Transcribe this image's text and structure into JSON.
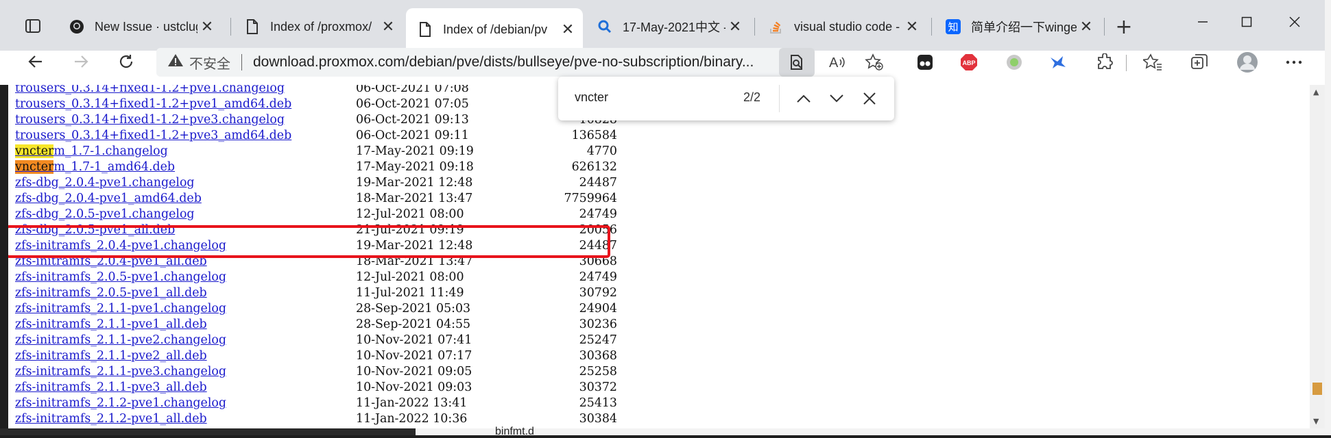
{
  "tabs": [
    {
      "title": "New Issue · ustclug/",
      "icon": "github-icon",
      "active": false
    },
    {
      "title": "Index of /proxmox/",
      "icon": "page-icon",
      "active": false
    },
    {
      "title": "Index of /debian/pv",
      "icon": "page-icon",
      "active": true
    },
    {
      "title": "17-May-2021中文 -",
      "icon": "search-icon",
      "active": false
    },
    {
      "title": "visual studio code -",
      "icon": "stackoverflow-icon",
      "active": false
    },
    {
      "title": "简单介绍一下winge",
      "icon": "zhihu-icon",
      "active": false
    }
  ],
  "address_bar": {
    "security_label": "不安全",
    "url": "download.proxmox.com/debian/pve/dists/bullseye/pve-no-subscription/binary..."
  },
  "find_bar": {
    "query": "vncter",
    "match_count": "2/2"
  },
  "listing": [
    {
      "name": "trousers_0.3.14+fixed1-1.2+pve1.changelog",
      "date": "06-Oct-2021 07:08",
      "size": ""
    },
    {
      "name": "trousers_0.3.14+fixed1-1.2+pve1_amd64.deb",
      "date": "06-Oct-2021 07:05",
      "size": ""
    },
    {
      "name": "trousers_0.3.14+fixed1-1.2+pve3.changelog",
      "date": "06-Oct-2021 09:13",
      "size": "10828"
    },
    {
      "name": "trousers_0.3.14+fixed1-1.2+pve3_amd64.deb",
      "date": "06-Oct-2021 09:11",
      "size": "136584"
    },
    {
      "name": "vncterm_1.7-1.changelog",
      "date": "17-May-2021 09:19",
      "size": "4770",
      "match": "vncter",
      "rest": "m_1.7-1.changelog",
      "hl": "other"
    },
    {
      "name": "vncterm_1.7-1_amd64.deb",
      "date": "17-May-2021 09:18",
      "size": "626132",
      "match": "vncter",
      "rest": "m_1.7-1_amd64.deb",
      "hl": "current"
    },
    {
      "name": "zfs-dbg_2.0.4-pve1.changelog",
      "date": "19-Mar-2021 12:48",
      "size": "24487"
    },
    {
      "name": "zfs-dbg_2.0.4-pve1_amd64.deb",
      "date": "18-Mar-2021 13:47",
      "size": "7759964"
    },
    {
      "name": "zfs-dbg_2.0.5-pve1.changelog",
      "date": "12-Jul-2021 08:00",
      "size": "24749"
    },
    {
      "name": "zfs-dbg_2.0.5-pve1_all.deb",
      "date": "21-Jul-2021 09:19",
      "size": "20056"
    },
    {
      "name": "zfs-initramfs_2.0.4-pve1.changelog",
      "date": "19-Mar-2021 12:48",
      "size": "24487"
    },
    {
      "name": "zfs-initramfs_2.0.4-pve1_all.deb",
      "date": "18-Mar-2021 13:47",
      "size": "30668"
    },
    {
      "name": "zfs-initramfs_2.0.5-pve1.changelog",
      "date": "12-Jul-2021 08:00",
      "size": "24749"
    },
    {
      "name": "zfs-initramfs_2.0.5-pve1_all.deb",
      "date": "11-Jul-2021 11:49",
      "size": "30792"
    },
    {
      "name": "zfs-initramfs_2.1.1-pve1.changelog",
      "date": "28-Sep-2021 05:03",
      "size": "24904"
    },
    {
      "name": "zfs-initramfs_2.1.1-pve1_all.deb",
      "date": "28-Sep-2021 04:55",
      "size": "30236"
    },
    {
      "name": "zfs-initramfs_2.1.1-pve2.changelog",
      "date": "10-Nov-2021 07:41",
      "size": "25247"
    },
    {
      "name": "zfs-initramfs_2.1.1-pve2_all.deb",
      "date": "10-Nov-2021 07:17",
      "size": "30368"
    },
    {
      "name": "zfs-initramfs_2.1.1-pve3.changelog",
      "date": "10-Nov-2021 09:05",
      "size": "25258"
    },
    {
      "name": "zfs-initramfs_2.1.1-pve3_all.deb",
      "date": "10-Nov-2021 09:03",
      "size": "30372"
    },
    {
      "name": "zfs-initramfs_2.1.2-pve1.changelog",
      "date": "11-Jan-2022 13:41",
      "size": "25413"
    },
    {
      "name": "zfs-initramfs_2.1.2-pve1_all.deb",
      "date": "11-Jan-2022 10:36",
      "size": "30384"
    }
  ],
  "background_text": "binfmt.d",
  "colors": {
    "link": "#1a1acc",
    "highlight_current": "#f28a21",
    "highlight_other": "#f7e62a",
    "annotation_box": "#e8141c"
  }
}
